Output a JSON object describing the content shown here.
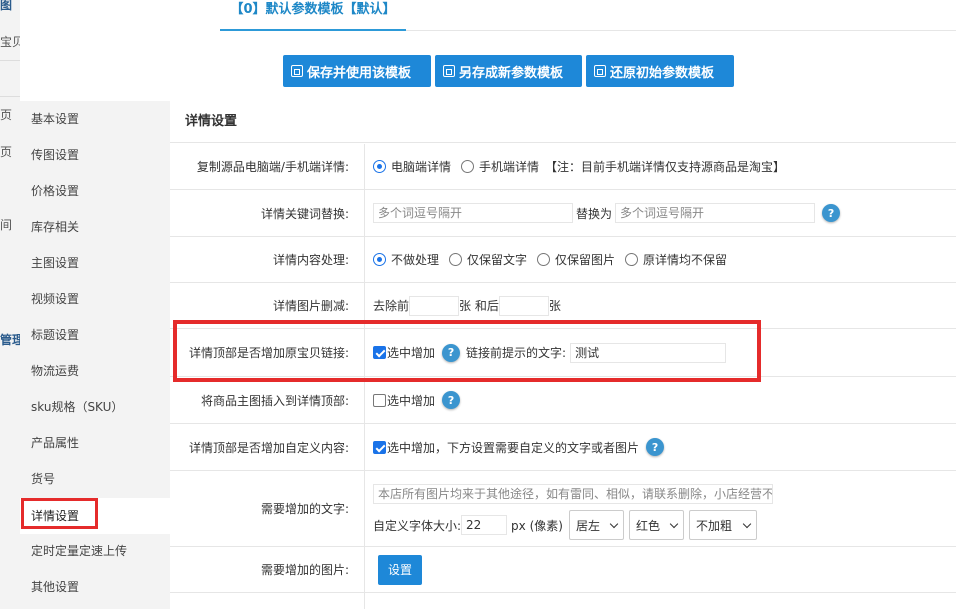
{
  "background_fragments": [
    "图",
    "宝贝",
    "页",
    "页",
    "间",
    "管理"
  ],
  "tab": {
    "title": "【0】默认参数模板【默认】"
  },
  "toolbar": {
    "save_use": "保存并使用该模板",
    "save_new": "另存成新参数模板",
    "restore": "还原初始参数模板"
  },
  "sidebar": {
    "items": [
      {
        "label": "基本设置"
      },
      {
        "label": "传图设置"
      },
      {
        "label": "价格设置"
      },
      {
        "label": "库存相关"
      },
      {
        "label": "主图设置"
      },
      {
        "label": "视频设置"
      },
      {
        "label": "标题设置"
      },
      {
        "label": "物流运费"
      },
      {
        "label": "sku规格（SKU）"
      },
      {
        "label": "产品属性"
      },
      {
        "label": "货号"
      },
      {
        "label": "详情设置"
      },
      {
        "label": "定时定量定速上传"
      },
      {
        "label": "其他设置"
      }
    ],
    "active_label": "详情设置"
  },
  "section": {
    "title": "详情设置"
  },
  "rows": {
    "copy_source": {
      "label": "复制源品电脑端/手机端详情:",
      "opt_pc": "电脑端详情",
      "opt_mobile": "手机端详情",
      "note": "【注：目前手机端详情仅支持源商品是淘宝】",
      "selected": "电脑端详情"
    },
    "keyword_replace": {
      "label": "详情关键词替换:",
      "placeholder_from": "多个词逗号隔开",
      "replace_with": "替换为",
      "placeholder_to": "多个词逗号隔开"
    },
    "content_process": {
      "label": "详情内容处理:",
      "options": [
        "不做处理",
        "仅保留文字",
        "仅保留图片",
        "原详情均不保留"
      ],
      "selected": "不做处理"
    },
    "image_trim": {
      "label": "详情图片删减:",
      "prefix": "去除前",
      "middle": "张 和后",
      "suffix": "张"
    },
    "top_link": {
      "label": "详情顶部是否增加原宝贝链接:",
      "check_label": "选中增加",
      "checked": true,
      "hint_label": "链接前提示的文字:",
      "hint_value": "测试"
    },
    "main_image_insert": {
      "label": "将商品主图插入到详情顶部:",
      "check_label": "选中增加",
      "checked": false
    },
    "custom_content": {
      "label": "详情顶部是否增加自定义内容:",
      "check_label": "选中增加，下方设置需要自定义的文字或者图片",
      "checked": true
    },
    "custom_text": {
      "label": "需要增加的文字:",
      "placeholder": "本店所有图片均来于其他途径，如有雷同、相似，请联系删除，小店经营不",
      "font_size_label": "自定义字体大小:",
      "font_size": "22",
      "unit": "px (像素)",
      "align": "居左",
      "color": "红色",
      "weight": "不加粗"
    },
    "custom_image": {
      "label": "需要增加的图片:",
      "button": "设置"
    }
  }
}
